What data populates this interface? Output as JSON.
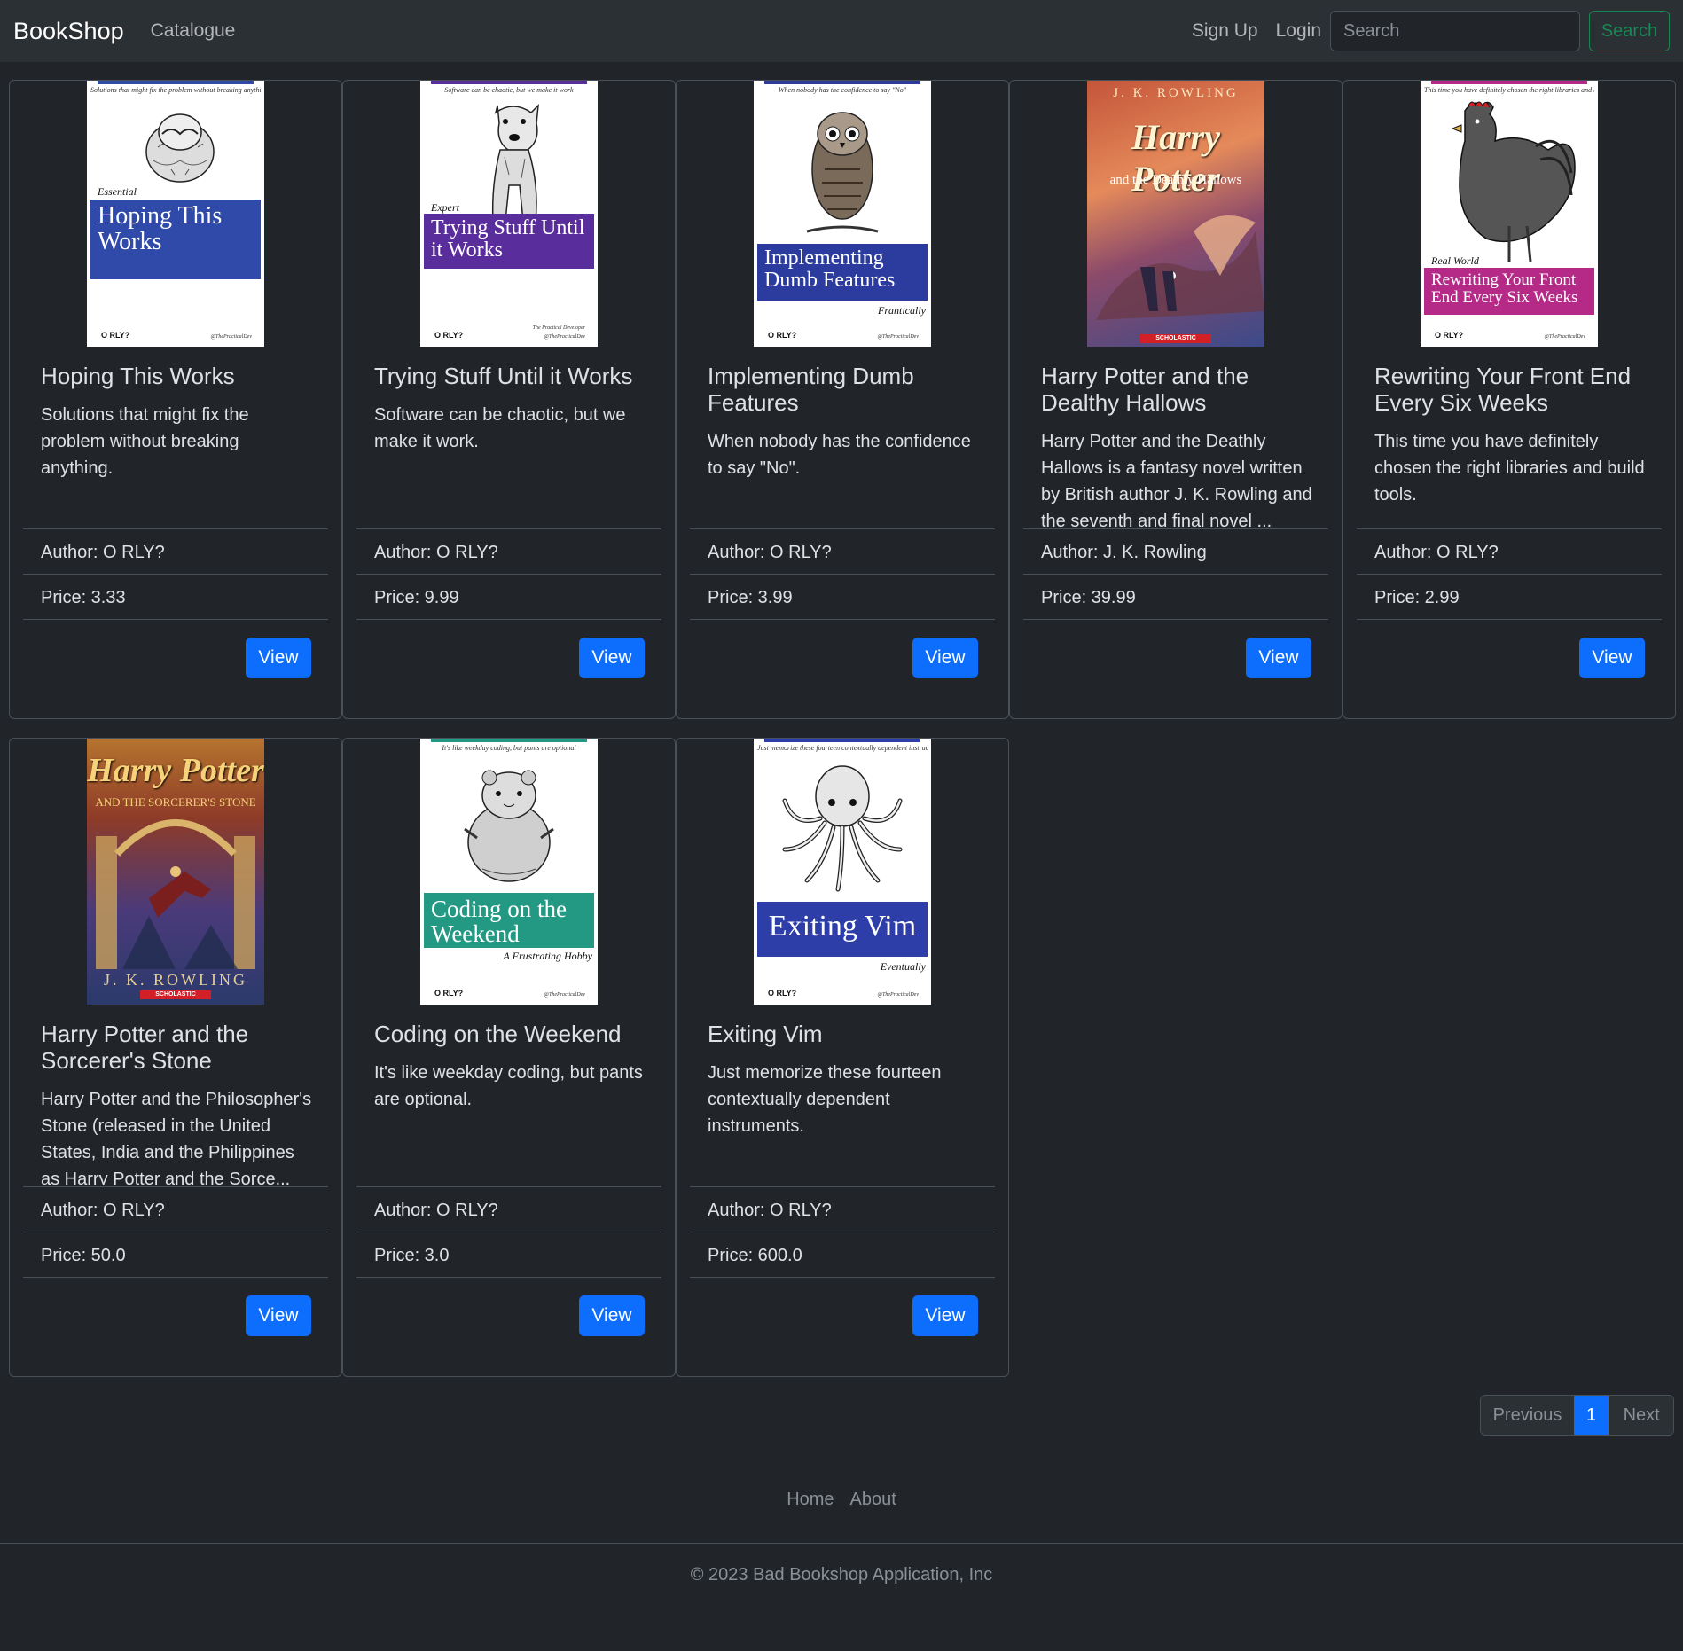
{
  "navbar": {
    "brand": "BookShop",
    "catalogue": "Catalogue",
    "signup": "Sign Up",
    "login": "Login",
    "search_placeholder": "Search",
    "search_button": "Search"
  },
  "books": [
    {
      "title": "Hoping This Works",
      "description": "Solutions that might fix the problem without breaking anything.",
      "author": "Author: O RLY?",
      "price": "Price: 3.33",
      "view": "View",
      "cover": {
        "tagline": "Solutions that might fix the problem without breaking anything",
        "pre": "Essential",
        "band": "Hoping This Works",
        "sub": "",
        "sub2": "",
        "logo": "O RLY?",
        "handle": "@ThePracticalDev",
        "color": "#2f4aa9",
        "animal": "hamster-eyes-icon"
      }
    },
    {
      "title": "Trying Stuff Until it Works",
      "description": "Software can be chaotic, but we make it work.",
      "author": "Author: O RLY?",
      "price": "Price: 9.99",
      "view": "View",
      "cover": {
        "tagline": "Software can be chaotic, but we make it work",
        "pre": "Expert",
        "band": "Trying Stuff Until it Works",
        "sub": "",
        "sub2": "The Practical Developer",
        "logo": "O RLY?",
        "handle": "@ThePracticalDev",
        "color": "#5a2d9c",
        "animal": "dog-icon"
      }
    },
    {
      "title": "Implementing Dumb Features",
      "description": "When nobody has the confidence to say \"No\".",
      "author": "Author: O RLY?",
      "price": "Price: 3.99",
      "view": "View",
      "cover": {
        "tagline": "When nobody has the confidence to say \"No\"",
        "pre": "",
        "band": "Implementing Dumb Features",
        "sub": "Frantically",
        "sub2": "",
        "logo": "O RLY?",
        "handle": "@ThePracticalDev",
        "color": "#2b3c9e",
        "animal": "owl-icon"
      }
    },
    {
      "title": "Harry Potter and the Dealthy Hallows",
      "description": "Harry Potter and the Deathly Hallows is a fantasy novel written by British author J. K. Rowling and the seventh and final novel ...",
      "author": "Author: J. K. Rowling",
      "price": "Price: 39.99",
      "view": "View",
      "cover": {
        "author_line": "J. K. ROWLING",
        "title_line": "Harry Potter",
        "sub_line": "and the Deathly Hallows",
        "publisher": "SCHOLASTIC"
      }
    },
    {
      "title": "Rewriting Your Front End Every Six Weeks",
      "description": "This time you have definitely chosen the right libraries and build tools.",
      "author": "Author: O RLY?",
      "price": "Price: 2.99",
      "view": "View",
      "cover": {
        "tagline": "This time you have definitely chosen the right libraries and build tools",
        "pre": "Real World",
        "band": "Rewriting Your Front End Every Six Weeks",
        "sub": "",
        "sub2": "",
        "logo": "O RLY?",
        "handle": "@ThePracticalDev",
        "color": "#b42a86",
        "animal": "rooster-icon"
      }
    },
    {
      "title": "Harry Potter and the Sorcerer's Stone",
      "description": "Harry Potter and the Philosopher's Stone (released in the United States, India and the Philippines as Harry Potter and the Sorce...",
      "author": "Author: O RLY?",
      "price": "Price: 50.0",
      "view": "View",
      "cover": {
        "author_line": "J. K. ROWLING",
        "title_line": "Harry Potter",
        "sub_line": "AND THE SORCERER'S STONE",
        "publisher": "SCHOLASTIC"
      }
    },
    {
      "title": "Coding on the Weekend",
      "description": "It's like weekday coding, but pants are optional.",
      "author": "Author: O RLY?",
      "price": "Price: 3.0",
      "view": "View",
      "cover": {
        "tagline": "It's like weekday coding, but pants are optional",
        "pre": "",
        "band": "Coding on the Weekend",
        "sub": "A Frustrating Hobby",
        "sub2": "",
        "logo": "O RLY?",
        "handle": "@ThePracticalDev",
        "color": "#239883",
        "animal": "hamster-icon"
      }
    },
    {
      "title": "Exiting Vim",
      "description": "Just memorize these fourteen contextually dependent instruments.",
      "author": "Author: O RLY?",
      "price": "Price: 600.0",
      "view": "View",
      "cover": {
        "tagline": "Just memorize these fourteen contextually dependent instructions",
        "pre": "",
        "band": "Exiting Vim",
        "sub": "Eventually",
        "sub2": "",
        "logo": "O RLY?",
        "handle": "@ThePracticalDev",
        "color": "#2d3ea8",
        "animal": "octopus-icon"
      }
    }
  ],
  "pagination": {
    "previous": "Previous",
    "current": "1",
    "next": "Next"
  },
  "footer": {
    "home": "Home",
    "about": "About",
    "copyright": "© 2023 Bad Bookshop Application, Inc"
  }
}
